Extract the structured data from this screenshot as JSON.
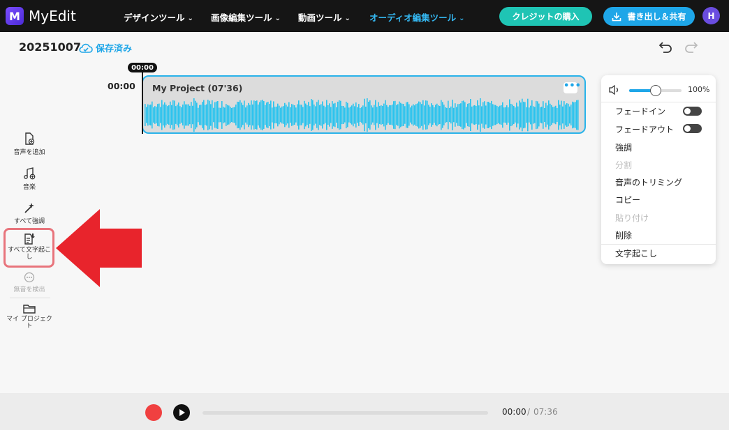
{
  "app": {
    "logo_letter": "M",
    "title": "MyEdit"
  },
  "nav": {
    "items": [
      {
        "label": "デザインツール"
      },
      {
        "label": "画像編集ツール"
      },
      {
        "label": "動画ツール"
      },
      {
        "label": "オーディオ編集ツール",
        "active": true
      }
    ],
    "credit_button": "クレジットの購入",
    "export_button": "書き出し＆共有",
    "avatar_letter": "H"
  },
  "project": {
    "name": "20251007",
    "save_status": "保存済み"
  },
  "timeline": {
    "playhead_time": "00:00",
    "track_start": "00:00",
    "clip_title": "My Project  (07'36)"
  },
  "sidebar": {
    "tools": [
      {
        "label": "音声を追加",
        "icon": "add-audio-icon"
      },
      {
        "label": "音楽",
        "icon": "music-add-icon"
      },
      {
        "label": "すべて強調",
        "icon": "magic-wand-icon"
      },
      {
        "label": "すべて文字起こし",
        "icon": "transcribe-icon",
        "highlighted": true
      },
      {
        "label": "無音を検出",
        "icon": "silence-detect-icon",
        "disabled": true
      },
      {
        "label": "マイ プロジェクト",
        "icon": "folder-icon"
      }
    ]
  },
  "context_menu": {
    "volume_percent": "100%",
    "volume_level": 0.5,
    "fade_in": "フェードイン",
    "fade_out": "フェードアウト",
    "enhance": "強調",
    "split": "分割",
    "trim": "音声のトリミング",
    "copy": "コピー",
    "paste": "貼り付け",
    "delete": "削除",
    "transcribe": "文字起こし"
  },
  "player": {
    "current_time": "00:00",
    "separator": "/",
    "total_time": "07:36",
    "progress": 0
  },
  "colors": {
    "accent": "#1ea6e8",
    "teal": "#1fc4b4",
    "highlight": "#e8747c",
    "arrow": "#e8242c",
    "waveform": "#29c3ee"
  }
}
